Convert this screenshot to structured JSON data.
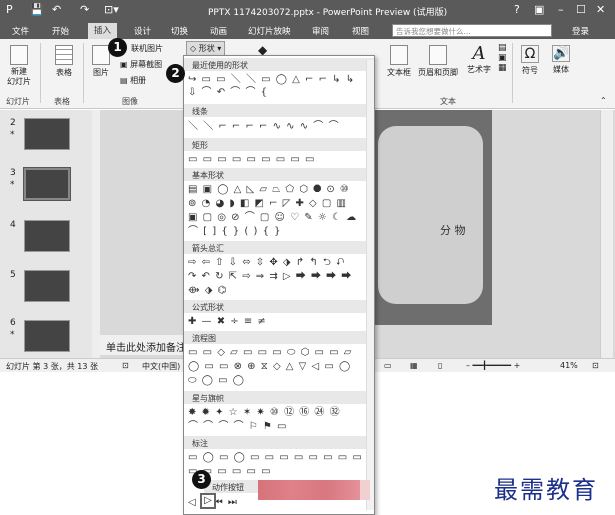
{
  "window": {
    "title": "PPTX 1174203072.pptx - PowerPoint Preview (试用版)",
    "quick_access": [
      "P",
      "💾",
      "↶",
      "↷",
      "⊡▾"
    ],
    "controls": [
      "?",
      "▣",
      "–",
      "☐",
      "✕"
    ]
  },
  "tabs": [
    "文件",
    "开始",
    "插入",
    "设计",
    "切换",
    "动画",
    "幻灯片放映",
    "审阅",
    "视图"
  ],
  "active_tab": "插入",
  "search_placeholder": "告诉我您想要做什么...",
  "login": "登录",
  "ribbon": {
    "new_slide": "新建\n幻灯片",
    "table": "表格",
    "picture": "图片",
    "online_picture": "联机图片",
    "screenshot": "屏幕截图",
    "album": "相册",
    "shapes": "形状",
    "textbox": "文本框",
    "header_footer": "页眉和页脚",
    "wordart": "艺术字",
    "symbol": "符号",
    "media": "媒体",
    "groups": {
      "slides": "幻灯片",
      "tables": "表格",
      "images": "图像",
      "text": "文本"
    }
  },
  "shapes_menu": {
    "sections": [
      {
        "title": "最近使用的形状",
        "rows": [
          "↪ ▭ ▭ ＼ ＼ ▭ ◯ △ ⌐ ⌐ ↳ ↳",
          "⇩ ⌒ ↶ ⌒ ⌒ {"
        ]
      },
      {
        "title": "线条",
        "rows": [
          "＼ ＼ ⌐ ⌐ ⌐ ⌐ ∿ ∿ ∿ ⌒ ⌒"
        ]
      },
      {
        "title": "矩形",
        "rows": [
          "▭ ▭ ▭ ▭ ▭ ▭ ▭ ▭ ▭"
        ]
      },
      {
        "title": "基本形状",
        "rows": [
          "▤ ▣ ◯ △ ◺ ▱ ⏢ ⬠ ⬡ ⯃ ⊙ ⑩",
          "⊚ ◔ ◕ ◗ ◧ ◩ ⌐ ◸ ✚ ◇ ▢ ▥",
          "▣ ▢ ◎ ⊘ ⌒ ▢ ☺ ♡ ✎ ☼ ☾ ☁",
          "⌒ [ ] { } ( ) { }"
        ]
      },
      {
        "title": "箭头总汇",
        "rows": [
          "⇨ ⇦ ⇧ ⇩ ⬄ ⇳ ✥ ⬗ ↱ ↰ ⮌ ⮏",
          "↷ ↶ ↻ ⇱ ⇨ ⇒ ⇉ ▷ ⮕ ⮕ ⮕ ⮕",
          "⟴ ⬗ ⌬"
        ]
      },
      {
        "title": "公式形状",
        "rows": [
          "✚ — ✖ ÷ ≡ ≠"
        ]
      },
      {
        "title": "流程图",
        "rows": [
          "▭ ▭ ◇ ▱ ▭ ▭ ▭ ⬭ ⬡ ▭ ▭ ▱",
          "◯ ▭ ▭ ⊗ ⊕ ⧖ ◇ △ ▽ ◁ ▭ ◯",
          "⬭ ◯ ▭ ◯"
        ]
      },
      {
        "title": "星与旗帜",
        "rows": [
          "✸ ✹ ✦ ☆ ✶ ✷ ⑩ ⑫ ⑯ ㉔ ㉜",
          "⌒ ⌒ ⌒ ⌒ ⚐ ⚑ ▭"
        ]
      },
      {
        "title": "标注",
        "rows": [
          "▭ ◯ ▭ ◯ ▭ ▭ ▭ ▭ ▭ ▭ ▭ ▭",
          "▭ ▭ ▭ ▭ ▭ ▭"
        ]
      },
      {
        "title": "动作按钮",
        "rows": [
          "◁ ▷ ⏮ ⏭"
        ]
      }
    ]
  },
  "thumbnails": [
    {
      "num": "2",
      "star": "*"
    },
    {
      "num": "3",
      "star": "*"
    },
    {
      "num": "4",
      "star": ""
    },
    {
      "num": "5",
      "star": ""
    },
    {
      "num": "6",
      "star": "*"
    }
  ],
  "slide_text": "分 物",
  "notes": "单击此处添加备注",
  "status": {
    "slide_info": "幻灯片 第 3 张，共 13 张",
    "lang": "中文(中国)",
    "zoom": "41%"
  },
  "badges": [
    "1",
    "2",
    "3"
  ],
  "watermark": "最需教育"
}
